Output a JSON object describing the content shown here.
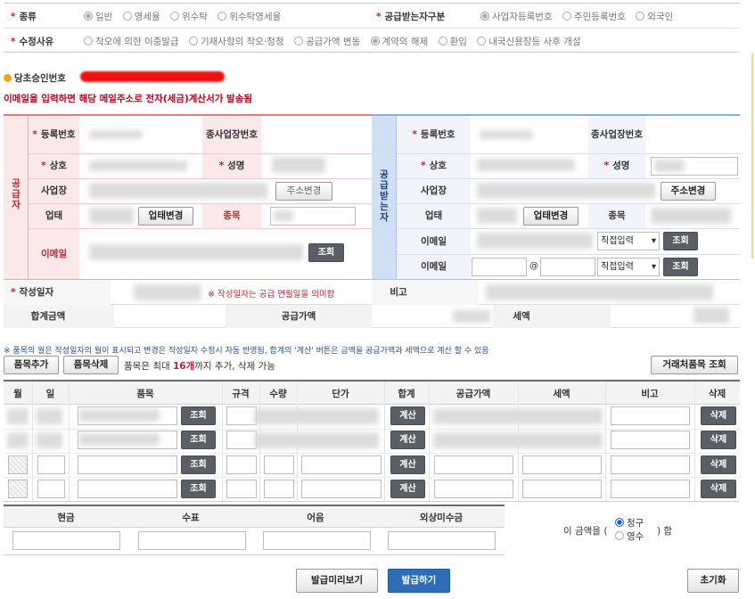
{
  "type_row": {
    "label": "종류",
    "options": [
      "일반",
      "영세율",
      "위수탁",
      "위수탁영세율"
    ],
    "selected": 0,
    "recipient_label": "공급받는자구분",
    "recipient_options": [
      "사업자등록번호",
      "주민등록번호",
      "외국인"
    ],
    "recipient_selected": 0
  },
  "reason_row": {
    "label": "수정사유",
    "options": [
      "착오에 의한 이중발급",
      "기재사항의 착오·정정",
      "공급가액 변동",
      "계약의 해제",
      "환입",
      "내국신용장등 사후 개설"
    ],
    "selected": 3
  },
  "approval": {
    "label": "당초승인번호",
    "notice": "이메일을 입력하면 해당 메일주소로 전자(세금)계산서가 발송됨"
  },
  "supplier": {
    "side_label": "공급자",
    "reg_no": "등록번호",
    "sub_no": "종사업장번호",
    "company": "상호",
    "name": "성명",
    "address": "사업장",
    "address_btn": "주소변경",
    "biz_type": "업태",
    "biz_btn": "업태변경",
    "item": "종목",
    "email": "이메일",
    "lookup": "조회"
  },
  "receiver": {
    "side_label": "공급받는자",
    "reg_no": "등록번호",
    "sub_no": "종사업장번호",
    "company": "상호",
    "name": "성명",
    "address": "사업장",
    "address_btn": "주소변경",
    "biz_type": "업태",
    "biz_btn": "업태변경",
    "item": "종목",
    "email": "이메일",
    "email2": "이메일",
    "at": "@",
    "direct_input": "직접입력",
    "lookup": "조회"
  },
  "date_row": {
    "label": "작성일자",
    "note": "※ 작성일자는 공급 연월일을 의미함",
    "remark": "비고"
  },
  "total_row": {
    "total": "합계금액",
    "supply": "공급가액",
    "tax": "세액"
  },
  "items_notice": "※ 품목의 월은 작성일자의 월이 표시되고 변경은 작성일자 수정시 자동 반영됨, 합계의 '계산' 버튼은 금액을 공급가액과 세액으로 계산 할 수 있음",
  "items_toolbar": {
    "add": "품목추가",
    "delete": "품목삭제",
    "note_pre": "품목은 최대 ",
    "note_count": "16개",
    "note_post": "까지 추가, 삭제 가능",
    "partner_lookup": "거래처품목 조회"
  },
  "items_headers": [
    "월",
    "일",
    "품목",
    "규격",
    "수량",
    "단가",
    "합계",
    "공급가액",
    "세액",
    "비고",
    "삭제"
  ],
  "item_buttons": {
    "lookup": "조회",
    "calc": "계산",
    "delete": "삭제"
  },
  "payment": {
    "headers": [
      "현금",
      "수표",
      "어음",
      "외상미수금"
    ],
    "amount_pre": "이 금액을 (",
    "claim": "청구",
    "receipt": "영수",
    "amount_post": ") 함"
  },
  "actions": {
    "preview": "발급미리보기",
    "issue": "발급하기",
    "reset": "초기화"
  }
}
